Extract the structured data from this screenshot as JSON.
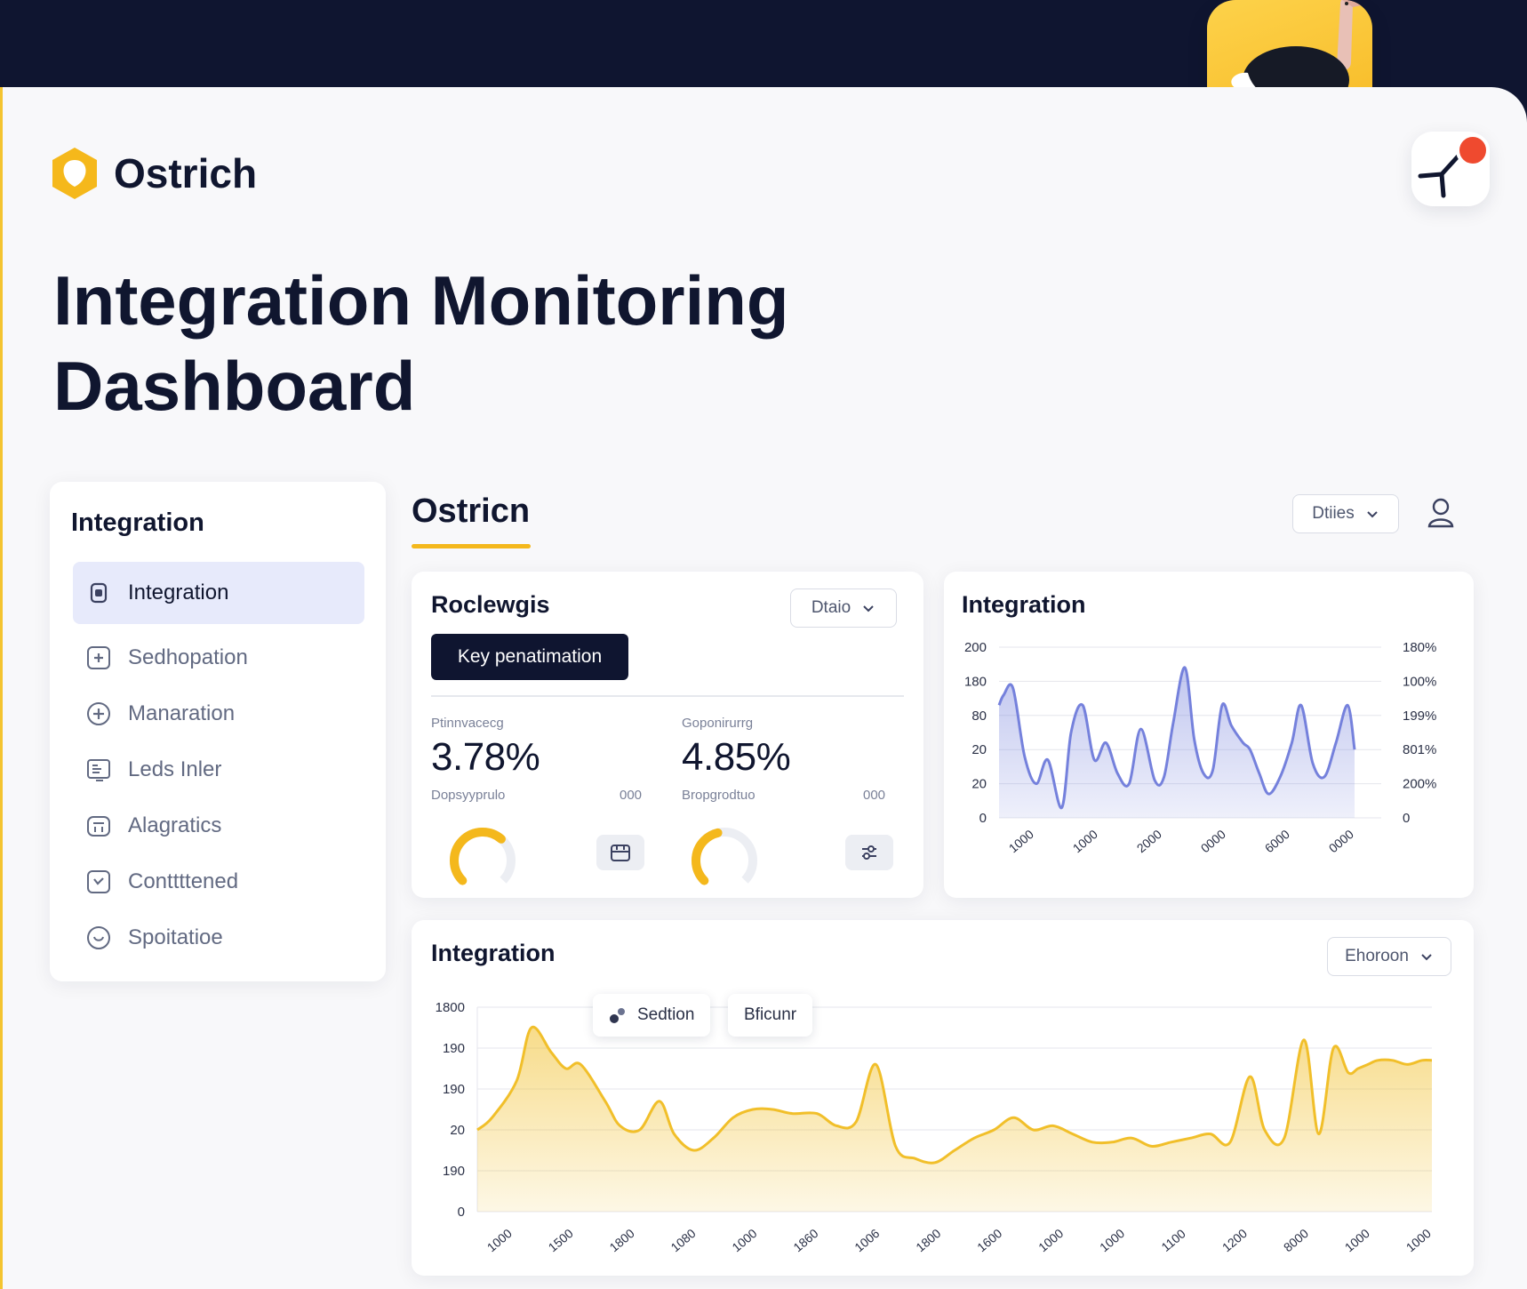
{
  "brand": {
    "name": "Ostrich"
  },
  "header": {
    "title_line1": "Integration Monitoring",
    "title_line2": "Dashboard"
  },
  "sidebar": {
    "title": "Integration",
    "items": [
      {
        "label": "Integration",
        "icon": "doc-icon",
        "active": true
      },
      {
        "label": "Sedhopation",
        "icon": "plus-square-icon",
        "active": false
      },
      {
        "label": "Manaration",
        "icon": "plus-circle-icon",
        "active": false
      },
      {
        "label": "Leds Inler",
        "icon": "report-icon",
        "active": false
      },
      {
        "label": "Alagratics",
        "icon": "box-icon",
        "active": false
      },
      {
        "label": "Conttttened",
        "icon": "check-square-icon",
        "active": false
      },
      {
        "label": "Spoitatioe",
        "icon": "smile-circle-icon",
        "active": false
      }
    ]
  },
  "main": {
    "title": "Ostricn",
    "filter_select": "Dtiies",
    "colors": {
      "accent": "#f4b81c",
      "navy": "#0f1530",
      "series_blue": "#7581dc",
      "series_yellow": "#f1bf2a"
    }
  },
  "metrics_card": {
    "title": "Roclewgis",
    "select": "Dtaio",
    "key_button": "Key penatimation",
    "metrics": [
      {
        "label": "Ptinnvacecg",
        "value": "3.78%",
        "sublabel": "Dopsyyprulo",
        "side": "000",
        "gauge": 0.65
      },
      {
        "label": "Goponirurrg",
        "value": "4.85%",
        "sublabel": "Bropgrodtuo",
        "side": "000",
        "gauge": 0.45
      }
    ]
  },
  "integration_chart": {
    "title": "Integration",
    "chart_data": {
      "type": "area",
      "left_axis_ticks": [
        "200",
        "180",
        "80",
        "20",
        "20",
        "0"
      ],
      "right_axis_ticks": [
        "180%",
        "100%",
        "199%",
        "801%",
        "200%",
        "0"
      ],
      "x_tick_labels": [
        "1000",
        "1000",
        "2000",
        "0000",
        "6000",
        "0000"
      ],
      "y_range": [
        0,
        5
      ],
      "grid": true,
      "series": [
        {
          "x": [
            0.0,
            0.2,
            0.6,
            1.1,
            1.6,
            2.1,
            2.7,
            3.1,
            3.6,
            4.1,
            4.6,
            5.1,
            5.6,
            6.1,
            6.7,
            7.1,
            7.5,
            8.0,
            8.4,
            8.8,
            9.2,
            9.6,
            10.0,
            10.5,
            10.8,
            11.2,
            11.6,
            12.1,
            12.6,
            13.0,
            13.5,
            14.0,
            14.5,
            15.0,
            15.3
          ],
          "y": [
            3.3,
            3.6,
            3.8,
            1.8,
            1.0,
            1.7,
            0.3,
            2.5,
            3.3,
            1.7,
            2.2,
            1.3,
            1.0,
            2.6,
            1.1,
            1.2,
            2.8,
            4.4,
            2.3,
            1.3,
            1.4,
            3.3,
            2.7,
            2.2,
            2.0,
            1.3,
            0.7,
            1.2,
            2.2,
            3.3,
            1.6,
            1.2,
            2.2,
            3.3,
            2.0
          ]
        }
      ]
    }
  },
  "bottom_chart": {
    "title": "Integration",
    "select": "Ehoroon",
    "legend": [
      {
        "label": "Sedtion"
      },
      {
        "label": "Bficunr"
      }
    ],
    "chart_data": {
      "type": "area",
      "y_ticks": [
        "1800",
        "190",
        "190",
        "20",
        "190",
        "0"
      ],
      "x_tick_labels": [
        "1000",
        "1500",
        "1800",
        "1080",
        "1000",
        "1860",
        "1006",
        "1800",
        "1600",
        "1000",
        "1000",
        "1100",
        "1200",
        "8000",
        "1000",
        "1000"
      ],
      "y_range": [
        0,
        5
      ],
      "grid": true,
      "series": [
        {
          "x": [
            0.0,
            0.3,
            0.8,
            1.1,
            1.5,
            1.8,
            2.1,
            2.6,
            2.9,
            3.3,
            3.7,
            4.0,
            4.4,
            4.8,
            5.2,
            5.6,
            6.0,
            6.4,
            6.9,
            7.3,
            7.7,
            8.1,
            8.5,
            8.9,
            9.3,
            9.7,
            10.1,
            10.5,
            10.9,
            11.3,
            11.7,
            12.1,
            12.5,
            12.9,
            13.3,
            13.7,
            14.1,
            14.5,
            14.9,
            15.3,
            15.7,
            16.0,
            16.4,
            16.8,
            17.1,
            17.4,
            17.7,
            17.9,
            18.1,
            18.3,
            18.6,
            18.9,
            19.2,
            19.4
          ],
          "y": [
            2.0,
            2.3,
            3.2,
            4.5,
            3.9,
            3.5,
            3.6,
            2.7,
            2.1,
            2.0,
            2.7,
            1.9,
            1.5,
            1.8,
            2.3,
            2.5,
            2.5,
            2.4,
            2.4,
            2.1,
            2.2,
            3.6,
            1.6,
            1.3,
            1.2,
            1.5,
            1.8,
            2.0,
            2.3,
            2.0,
            2.1,
            1.9,
            1.7,
            1.7,
            1.8,
            1.6,
            1.7,
            1.8,
            1.9,
            1.7,
            3.3,
            2.0,
            1.8,
            4.2,
            1.9,
            4.0,
            3.4,
            3.5,
            3.6,
            3.7,
            3.7,
            3.6,
            3.7,
            3.7
          ]
        }
      ]
    }
  }
}
